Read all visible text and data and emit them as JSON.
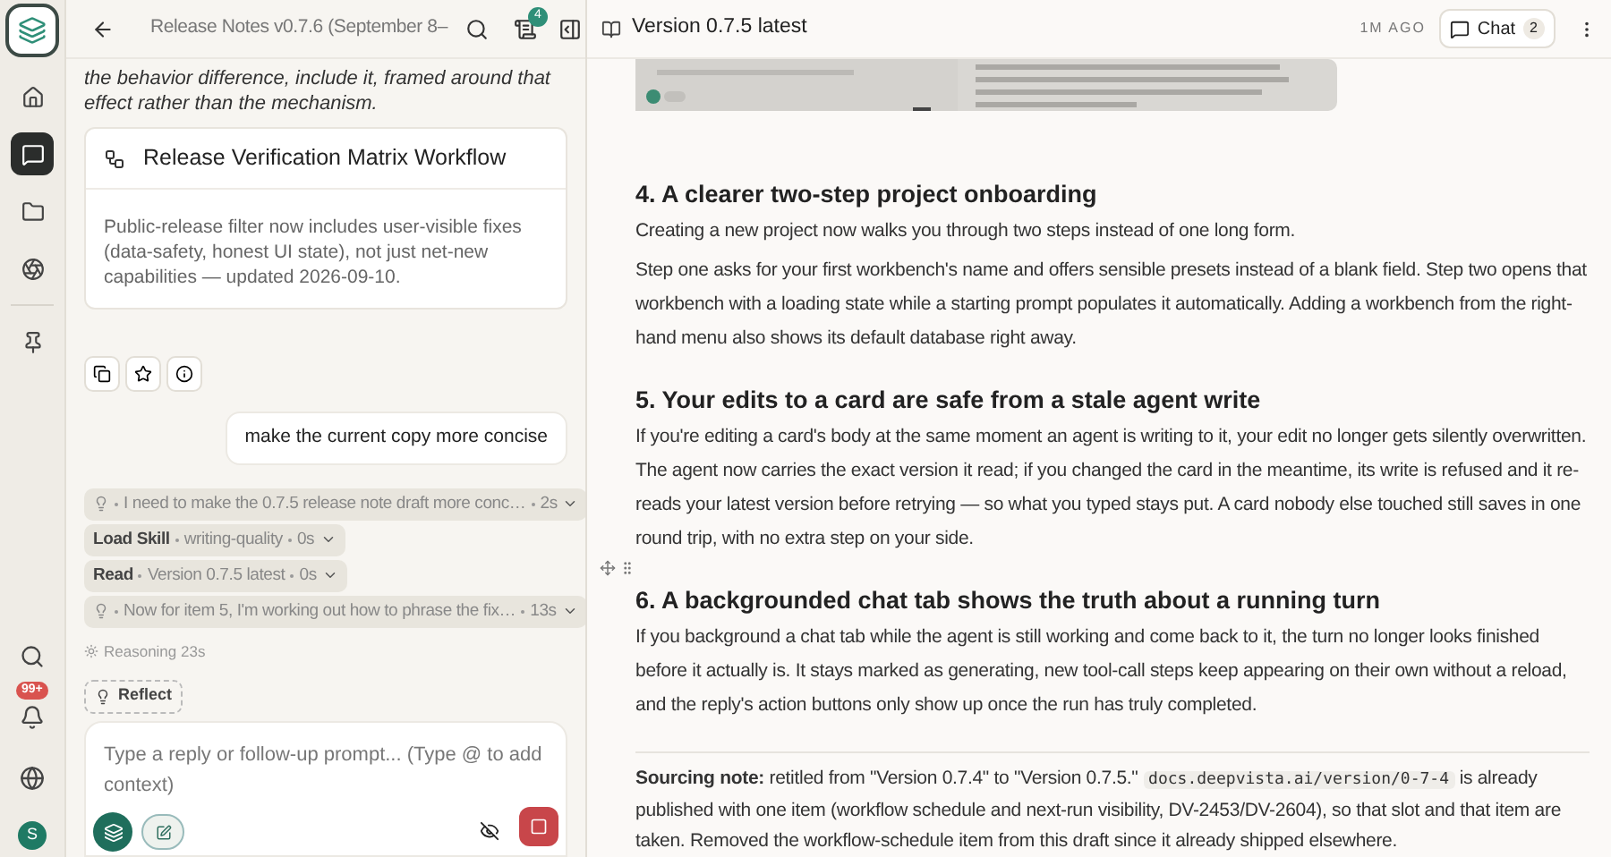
{
  "rail": {
    "items": [
      {
        "selected": false
      },
      {
        "selected": true
      },
      {
        "selected": false
      },
      {
        "selected": false
      },
      {
        "selected": false
      }
    ],
    "notifications_badge": "99+",
    "avatar": "S"
  },
  "chat": {
    "title": "Release Notes v0.7.6 (September 8–",
    "badge": "4",
    "intro": "the behavior difference, include it, framed around that effect rather than the mechanism.",
    "card": {
      "title": "Release Verification Matrix Workflow",
      "body": "Public-release filter now includes user-visible fixes (data-safety, honest UI state), not just net-new capabilities — updated 2026-09-10."
    },
    "user_message": "make the current copy more concise",
    "steps": [
      {
        "kind": "thought",
        "text": "I need to make the 0.7.5 release note draft more conc…",
        "time": "2s"
      },
      {
        "kind": "tool",
        "name": "Load Skill",
        "text": "writing-quality",
        "time": "0s"
      },
      {
        "kind": "tool",
        "name": "Read",
        "text": "Version 0.7.5 latest",
        "time": "0s"
      },
      {
        "kind": "thought",
        "text": "Now for item 5, I'm working out how to phrase the fix…",
        "time": "13s"
      }
    ],
    "reasoning": "Reasoning 23s",
    "reflect": "Reflect",
    "composer": {
      "placeholder": "Type a reply or follow-up prompt... (Type @ to add context)"
    }
  },
  "doc": {
    "title": "Version 0.7.5 latest",
    "updated": "1M AGO",
    "chat_button": "Chat",
    "chat_count": "2",
    "sections": [
      {
        "heading": "4. A clearer two-step project onboarding",
        "paragraphs": [
          "Creating a new project now walks you through two steps instead of one long form.",
          "Step one asks for your first workbench's name and offers sensible presets instead of a blank field. Step two opens that workbench with a loading state while a starting prompt populates it automatically. Adding a workbench from the right-hand menu also shows its default database right away."
        ]
      },
      {
        "heading": "5. Your edits to a card are safe from a stale agent write",
        "paragraphs": [
          "If you're editing a card's body at the same moment an agent is writing to it, your edit no longer gets silently overwritten. The agent now carries the exact version it read; if you changed the card in the meantime, its write is refused and it re-reads your latest version before retrying — so what you typed stays put. A card nobody else touched still saves in one round trip, with no extra step on your side."
        ]
      },
      {
        "heading": "6. A backgrounded chat tab shows the truth about a running turn",
        "paragraphs": [
          "If you background a chat tab while the agent is still working and come back to it, the turn no longer looks finished before it actually is. It stays marked as generating, new tool-call steps keep appearing on their own without a reload, and the reply's action buttons only show up once the run has truly completed."
        ]
      }
    ],
    "note": {
      "before": "**Sourcing note:** retitled from \"Version 0.7.4\" to \"Version 0.7.5.\"",
      "code": "docs.deepvista.ai/version/0-7-4",
      "after": "is already published with one item (workflow schedule and next-run visibility, DV-2453/DV-2604), so that slot and that item are taken. Removed the workflow-schedule item from this draft since it already shipped elsewhere."
    }
  }
}
